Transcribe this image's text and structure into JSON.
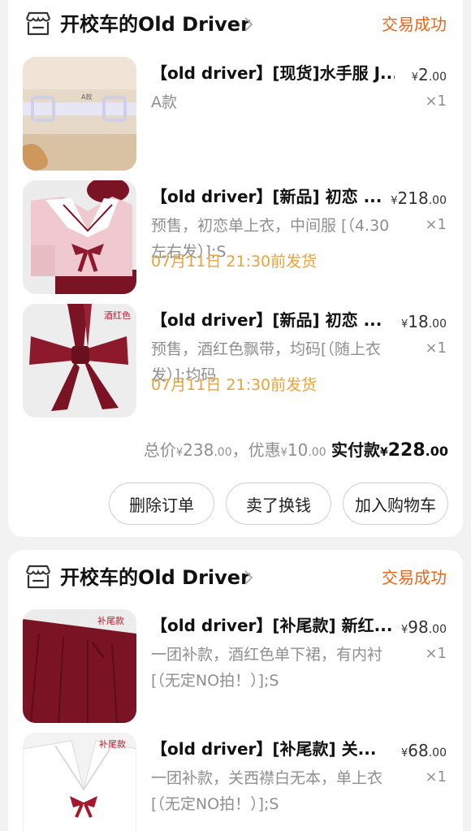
{
  "orders": [
    {
      "shop_name": "开校车的Old Driver",
      "status": "交易成功",
      "items": [
        {
          "title": "【old driver】[现货]水手服 J...",
          "price_currency": "¥",
          "price_int": "2",
          "price_dec": ".00",
          "spec": "A款",
          "qty": "×1",
          "ship_note": ""
        },
        {
          "title": "【old driver】[新品] 初恋 ...",
          "price_currency": "¥",
          "price_int": "218",
          "price_dec": ".00",
          "spec": "预售，初恋单上衣，中间服 [（4.30左右发）];S",
          "qty": "×1",
          "ship_note": "07月11日 21:30前发货"
        },
        {
          "title": "【old driver】[新品] 初恋 ...",
          "price_currency": "¥",
          "price_int": "18",
          "price_dec": ".00",
          "spec": "预售，酒红色飘带，均码[（随上衣发）];均码",
          "qty": "×1",
          "ship_note": "07月11日 21:30前发货"
        }
      ],
      "totals": {
        "total_label": "总价",
        "total_currency": "¥",
        "total_int": "238",
        "total_dec": ".00",
        "sep": "，",
        "discount_label": "优惠",
        "discount_currency": "¥",
        "discount_int": "10",
        "discount_dec": ".00",
        "paid_label": "实付款",
        "paid_currency": "¥",
        "paid_int": "228",
        "paid_dec": ".00"
      },
      "buttons": {
        "delete": "删除订单",
        "resell": "卖了换钱",
        "add_cart": "加入购物车"
      }
    },
    {
      "shop_name": "开校车的Old Driver",
      "status": "交易成功",
      "items": [
        {
          "title": "【old driver】[补尾款] 新红...",
          "price_currency": "¥",
          "price_int": "98",
          "price_dec": ".00",
          "spec": "一团补款，酒红色单下裙，有内衬[（无定NO拍！）];S",
          "qty": "×1",
          "thumb_label": "补尾款"
        },
        {
          "title": "【old driver】[补尾款] 关...",
          "price_currency": "¥",
          "price_int": "68",
          "price_dec": ".00",
          "spec": "一团补款，关西襟白无本，单上衣[（无定NO拍！）];S",
          "qty": "×1",
          "thumb_label": "补尾款"
        }
      ]
    }
  ],
  "thumb_text": {
    "a_tag": "A款",
    "wine_red": "酒红色"
  },
  "colors": {
    "status_orange": "#e8661c",
    "ship_orange": "#e8a33a",
    "wine": "#7a1324"
  },
  "icons": {
    "store": "store-icon",
    "chevron": "chevron-right-icon"
  }
}
